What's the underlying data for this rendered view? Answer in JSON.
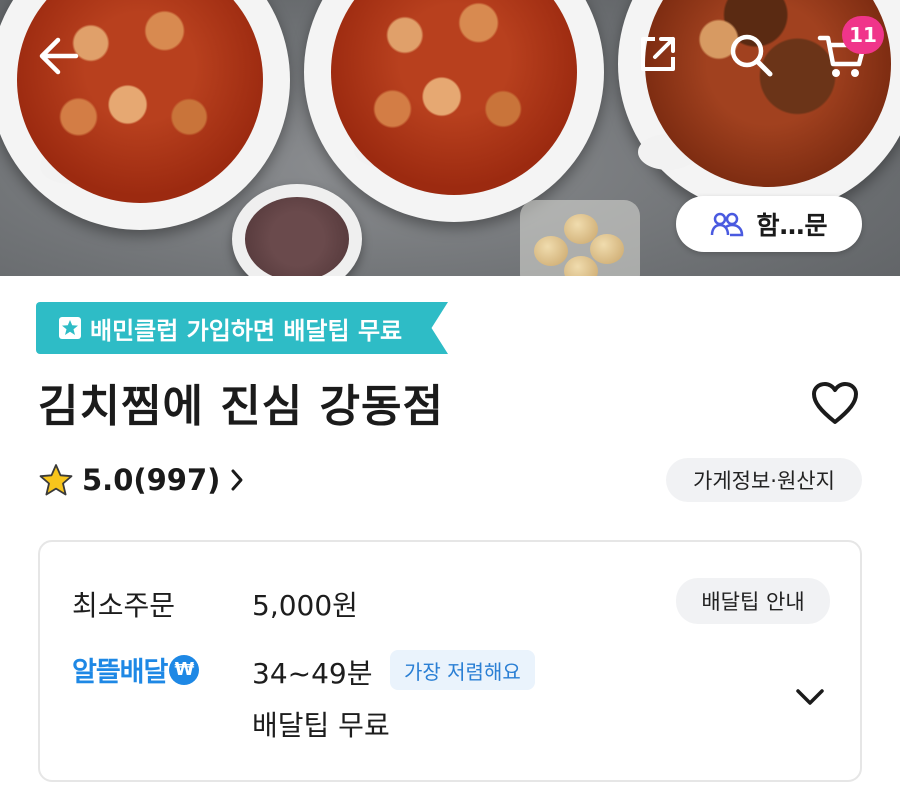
{
  "header": {
    "back_icon": "arrow-left-icon",
    "share_icon": "share-icon",
    "search_icon": "search-icon",
    "cart_icon": "cart-icon",
    "cart_count": "11",
    "group_order": {
      "icon": "people-icon",
      "label": "함…문"
    }
  },
  "promo": {
    "icon": "star-badge-icon",
    "label": "배민클럽 가입하면 배달팁 무료",
    "color": "#2ebcc6"
  },
  "store": {
    "name": "김치찜에 진심 강동점",
    "heart_icon": "heart-icon",
    "rating": "5.0(997)",
    "info_button": "가게정보·원산지"
  },
  "delivery": {
    "min_order_label": "최소주문",
    "min_order_value": "5,000원",
    "tip_guide_button": "배달팁 안내",
    "service_name": "알뜰배달",
    "time": "34~49분",
    "badge": "가장 저렴해요",
    "tip": "배달팁 무료",
    "accent": "#1e88e5"
  },
  "colors": {
    "cart_badge": "#f0358a"
  }
}
